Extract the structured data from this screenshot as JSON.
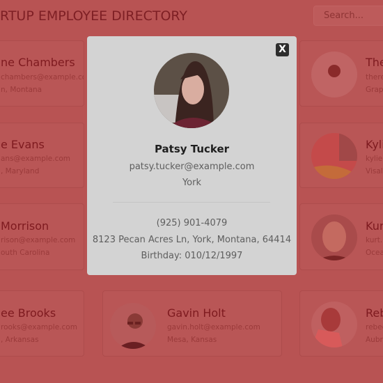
{
  "header": {
    "title": "RTUP EMPLOYEE DIRECTORY",
    "search_placeholder": "Search..."
  },
  "cards": [
    {
      "name": "ne Chambers",
      "email": "chambers@example.com",
      "location": "n, Montana"
    },
    {
      "name": "e Evans",
      "email": "ans@example.com",
      "location": ", Maryland"
    },
    {
      "name": "Morrison",
      "email": "rison@example.com",
      "location": "outh Carolina"
    },
    {
      "name": "ee Brooks",
      "email": "rooks@example.com",
      "location": ", Arkansas"
    },
    {
      "name": "Gavin Holt",
      "email": "gavin.holt@example.com",
      "location": "Mesa, Kansas"
    },
    {
      "name": "The",
      "email": "there",
      "location": "Grap"
    },
    {
      "name": "Kyli",
      "email": "kylie.",
      "location": "Visal"
    },
    {
      "name": "Kur",
      "email": "kurt.",
      "location": "Ocea"
    },
    {
      "name": "Reb",
      "email": "rebec",
      "location": "Aubr"
    }
  ],
  "modal": {
    "close_label": "X",
    "name": "Patsy Tucker",
    "email": "patsy.tucker@example.com",
    "city": "York",
    "phone": "(925) 901-4079",
    "address": "8123 Pecan Acres Ln, York, Montana, 64414",
    "birthday": "Birthday: 010/12/1997"
  }
}
